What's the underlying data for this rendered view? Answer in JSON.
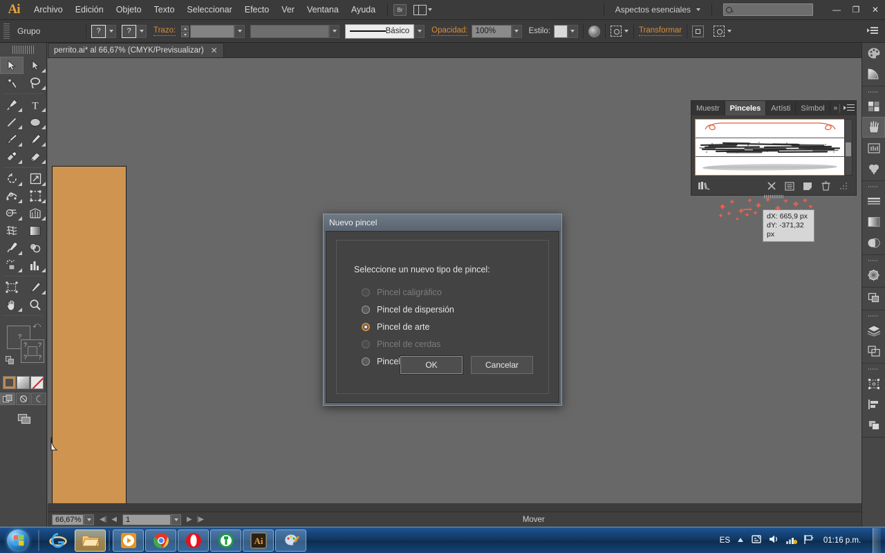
{
  "app": {
    "logo": "Ai",
    "menus": [
      "Archivo",
      "Edición",
      "Objeto",
      "Texto",
      "Seleccionar",
      "Efecto",
      "Ver",
      "Ventana",
      "Ayuda"
    ],
    "bridge_button": "Br",
    "workspace": "Aspectos esenciales",
    "search_placeholder": "",
    "window_buttons": {
      "minimize": "—",
      "restore": "❐",
      "close": "✕"
    }
  },
  "control_bar": {
    "context_label": "Grupo",
    "fill_value": "?",
    "stroke_value": "?",
    "stroke_label": "Trazo:",
    "stroke_weight": "",
    "stroke_profile": "",
    "brush_definition": "Básico",
    "opacity_label": "Opacidad:",
    "opacity_value": "100%",
    "style_label": "Estilo:",
    "transform_label": "Transformar"
  },
  "toolbar": {
    "tools": [
      "selection-tool",
      "direct-selection-tool",
      "magic-wand-tool",
      "lasso-tool",
      "pen-tool",
      "type-tool",
      "line-segment-tool",
      "ellipse-tool",
      "paintbrush-tool",
      "pencil-tool",
      "blob-brush-tool",
      "eraser-tool",
      "rotate-tool",
      "scale-tool",
      "width-tool",
      "free-transform-tool",
      "shape-builder-tool",
      "perspective-grid-tool",
      "mesh-tool",
      "gradient-tool",
      "eyedropper-tool",
      "blend-tool",
      "symbol-sprayer-tool",
      "column-graph-tool",
      "artboard-tool",
      "slice-tool",
      "hand-tool",
      "zoom-tool"
    ],
    "fill_stroke": {
      "fill": "?",
      "stroke": "?"
    },
    "color_modes": [
      "color-mode",
      "gradient-mode",
      "none-mode"
    ],
    "draw_modes": [
      "draw-normal",
      "draw-behind",
      "draw-inside"
    ],
    "screen_mode": "screen-mode-button"
  },
  "document": {
    "tab_title": "perrito.ai* al 66,67% (CMYK/Previsualizar)",
    "tab_close": "✕",
    "artboard_color": "#cf9450"
  },
  "status_bar": {
    "zoom": "66,67%",
    "page": "1",
    "status_text": "Mover"
  },
  "brushes_panel": {
    "tabs": [
      "Muestr",
      "Pinceles",
      "Artísti",
      "Símbol"
    ],
    "active_tab": "Pinceles",
    "footer_icons": [
      "brush-libraries-icon",
      "remove-brush-link-icon",
      "options-icon",
      "new-brush-icon",
      "delete-brush-icon"
    ],
    "brush_rows": [
      "arc-brush-preview",
      "charcoal-brush-preview",
      "gray-wash-brush-preview"
    ]
  },
  "tooltip": {
    "dx": "dX: 665,9 px",
    "dy": "dY: -371,32 px"
  },
  "dialog": {
    "title": "Nuevo pincel",
    "prompt": "Seleccione un nuevo tipo de pincel:",
    "options": [
      {
        "label": "Pincel caligráfico",
        "selected": false,
        "disabled": true
      },
      {
        "label": "Pincel de dispersión",
        "selected": false,
        "disabled": false
      },
      {
        "label": "Pincel de arte",
        "selected": true,
        "disabled": false
      },
      {
        "label": "Pincel de cerdas",
        "selected": false,
        "disabled": true
      },
      {
        "label": "Pincel de motivo",
        "selected": false,
        "disabled": false
      }
    ],
    "ok_label": "OK",
    "cancel_label": "Cancelar",
    "accent_color": "#d78a3c"
  },
  "dock": {
    "groups": [
      [
        "color-panel-icon",
        "color-guide-icon"
      ],
      [
        "swatches-panel-icon",
        "brushes-panel-icon",
        "symbols-panel-icon",
        "graphic-styles-icon"
      ],
      [
        "stroke-panel-icon",
        "gradient-panel-icon",
        "transparency-panel-icon"
      ],
      [
        "appearance-panel-icon"
      ],
      [
        "pathfinder-panel-icon"
      ],
      [
        "layers-panel-icon",
        "artboards-panel-icon"
      ],
      [
        "transform-panel-icon",
        "align-panel-icon",
        "pathfinder-icon-2"
      ]
    ],
    "selected": "brushes-panel-icon"
  },
  "taskbar": {
    "start": "start-orb",
    "pinned": [
      "internet-explorer-icon",
      "windows-explorer-icon"
    ],
    "running": [
      "media-player-icon",
      "google-chrome-icon",
      "opera-icon",
      "antivirus-icon",
      "illustrator-icon",
      "paint-icon"
    ],
    "language": "ES",
    "tray_icons": [
      "show-hidden-icons",
      "action-center-icon",
      "volume-icon",
      "network-icon",
      "flag-icon"
    ],
    "clock": "01:16 p.m."
  }
}
